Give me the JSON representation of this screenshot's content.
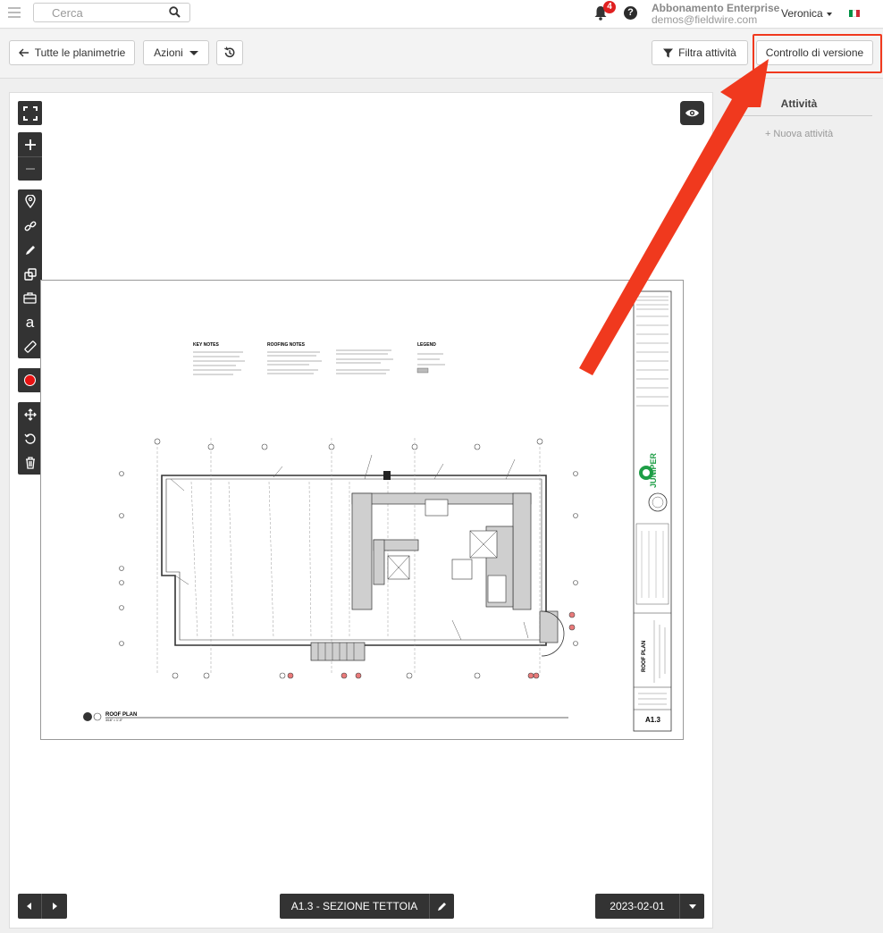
{
  "topbar": {
    "search_placeholder": "Cerca",
    "notification_count": "4",
    "help_label": "?",
    "plan_name": "Abbonamento Enterprise",
    "email": "demos@fieldwire.com",
    "user_name": "Veronica",
    "flag_colors": [
      "#009246",
      "#ffffff",
      "#ce2b37"
    ]
  },
  "toolbar": {
    "all_plans_label": "Tutte le planimetrie",
    "actions_label": "Azioni",
    "filter_tasks_label": "Filtra attività",
    "version_control_label": "Controllo di versione"
  },
  "sidebar": {
    "title": "Attività",
    "new_task": "+ Nuova attività"
  },
  "viewer": {
    "text_tool_glyph": "a",
    "sheet_label": "A1.3 - SEZIONE TETTOIA",
    "date_label": "2023-02-01"
  },
  "drawing": {
    "key_notes_title": "KEY NOTES",
    "roofing_notes_title": "ROOFING NOTES",
    "legend_title": "LEGEND",
    "plan_title": "ROOF PLAN",
    "scale": "3/16\" = 1'-0\"",
    "brand": "JUNIPER",
    "sheet_title": "ROOF PLAN",
    "sheet_number": "A1.3"
  },
  "colors": {
    "accent_red": "#f0391e",
    "dark_tool": "#333333",
    "record_red": "#e81212"
  }
}
